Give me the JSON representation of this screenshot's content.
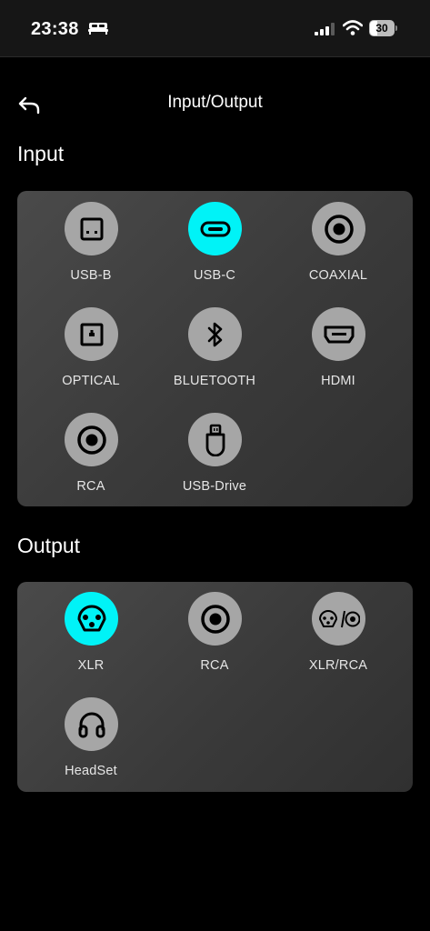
{
  "status_bar": {
    "time": "23:38",
    "battery_level": "30",
    "icons": [
      "bed-icon",
      "signal-icon",
      "wifi-icon",
      "battery-icon"
    ]
  },
  "header": {
    "title": "Input/Output",
    "back_icon": "back-arrow-icon"
  },
  "input": {
    "title": "Input",
    "items": [
      {
        "label": "USB-B",
        "icon": "usb-b-icon",
        "active": false
      },
      {
        "label": "USB-C",
        "icon": "usb-c-icon",
        "active": true
      },
      {
        "label": "COAXIAL",
        "icon": "coaxial-icon",
        "active": false
      },
      {
        "label": "OPTICAL",
        "icon": "optical-icon",
        "active": false
      },
      {
        "label": "BLUETOOTH",
        "icon": "bluetooth-icon",
        "active": false
      },
      {
        "label": "HDMI",
        "icon": "hdmi-icon",
        "active": false
      },
      {
        "label": "RCA",
        "icon": "rca-icon",
        "active": false
      },
      {
        "label": "USB-Drive",
        "icon": "usb-drive-icon",
        "active": false
      }
    ]
  },
  "output": {
    "title": "Output",
    "items": [
      {
        "label": "XLR",
        "icon": "xlr-icon",
        "active": true
      },
      {
        "label": "RCA",
        "icon": "rca-icon",
        "active": false
      },
      {
        "label": "XLR/RCA",
        "icon": "xlr-rca-icon",
        "active": false
      },
      {
        "label": "HeadSet",
        "icon": "headset-icon",
        "active": false
      }
    ]
  },
  "colors": {
    "background": "#000000",
    "active": "#00f3f7",
    "inactive": "#a6a6a6",
    "panel": "#404040"
  }
}
